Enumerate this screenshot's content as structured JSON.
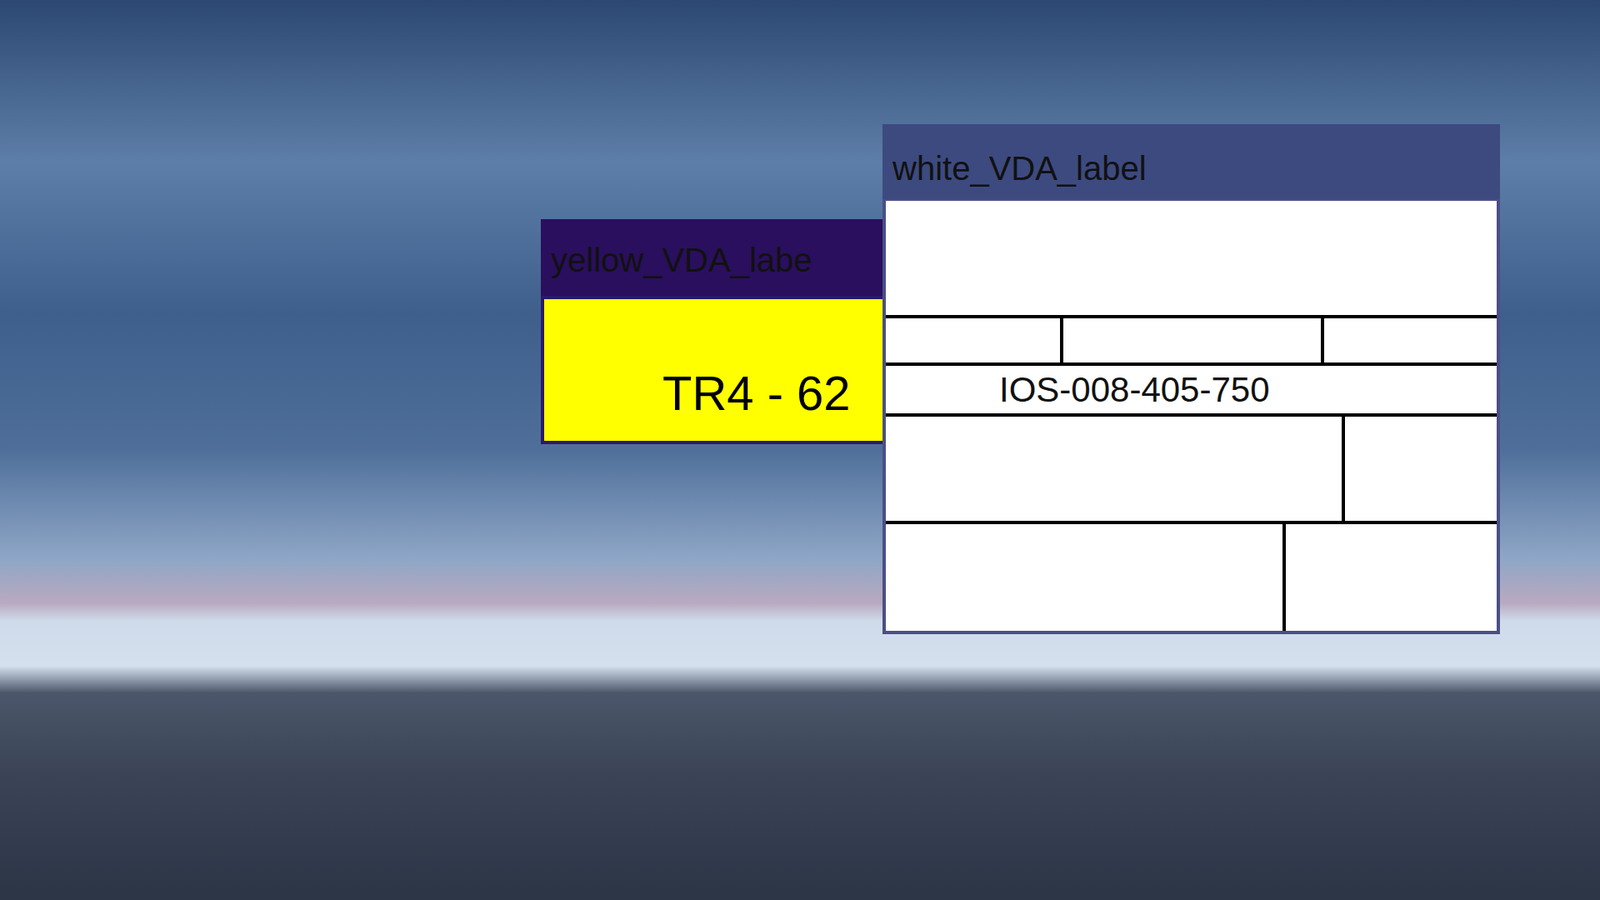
{
  "windows": [
    {
      "title": "yellow_VDA_labe",
      "text": "TR4 - 62"
    },
    {
      "title": "white_VDA_label",
      "rows": [
        {
          "cells": [
            ""
          ]
        },
        {
          "cells": [
            "",
            "",
            ""
          ]
        },
        {
          "cells": [
            "IOS-008-405-750"
          ]
        },
        {
          "cells": [
            "",
            ""
          ]
        },
        {
          "cells": [
            "",
            ""
          ]
        }
      ]
    }
  ]
}
